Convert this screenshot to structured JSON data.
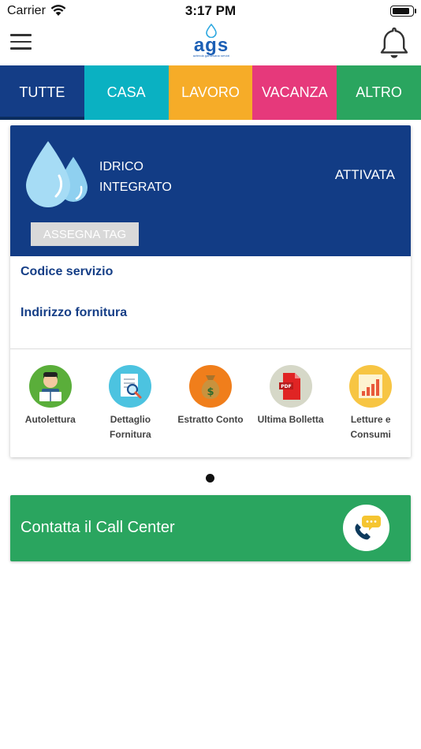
{
  "status_bar": {
    "carrier": "Carrier",
    "time": "3:17 PM",
    "battery_level": 0.9
  },
  "nav": {
    "logo_text": "ags",
    "logo_tagline": "azienda gardesana servizi",
    "icons": {
      "menu": "hamburger-icon",
      "notifications": "bell-icon"
    }
  },
  "tabs": [
    {
      "label": "TUTTE",
      "color": "#143d86",
      "active": true
    },
    {
      "label": "CASA",
      "color": "#0ab1c2",
      "active": false
    },
    {
      "label": "LAVORO",
      "color": "#f6ac28",
      "active": false
    },
    {
      "label": "VACANZA",
      "color": "#e6397b",
      "active": false
    },
    {
      "label": "ALTRO",
      "color": "#2aa55f",
      "active": false
    }
  ],
  "service_card": {
    "name_line1": "IDRICO",
    "name_line2": "INTEGRATO",
    "status": "ATTIVATA",
    "assign_tag_label": "ASSEGNA TAG",
    "service_code_label": "Codice servizio",
    "supply_address_label": "Indirizzo fornitura",
    "header_color": "#123c85",
    "icon": "water-drops-icon"
  },
  "actions": [
    {
      "label": "Autolettura",
      "icon": "meter-reading-icon"
    },
    {
      "label": "Dettaglio Fornitura",
      "icon": "document-search-icon"
    },
    {
      "label": "Estratto Conto",
      "icon": "money-bag-icon"
    },
    {
      "label": "Ultima Bolletta",
      "icon": "pdf-icon"
    },
    {
      "label": "Letture e Consumi",
      "icon": "bar-chart-icon"
    }
  ],
  "pagination": {
    "current": 1,
    "total": 1
  },
  "call_center": {
    "label": "Contatta il Call Center",
    "color": "#2aa55f",
    "icon": "phone-chat-icon"
  }
}
